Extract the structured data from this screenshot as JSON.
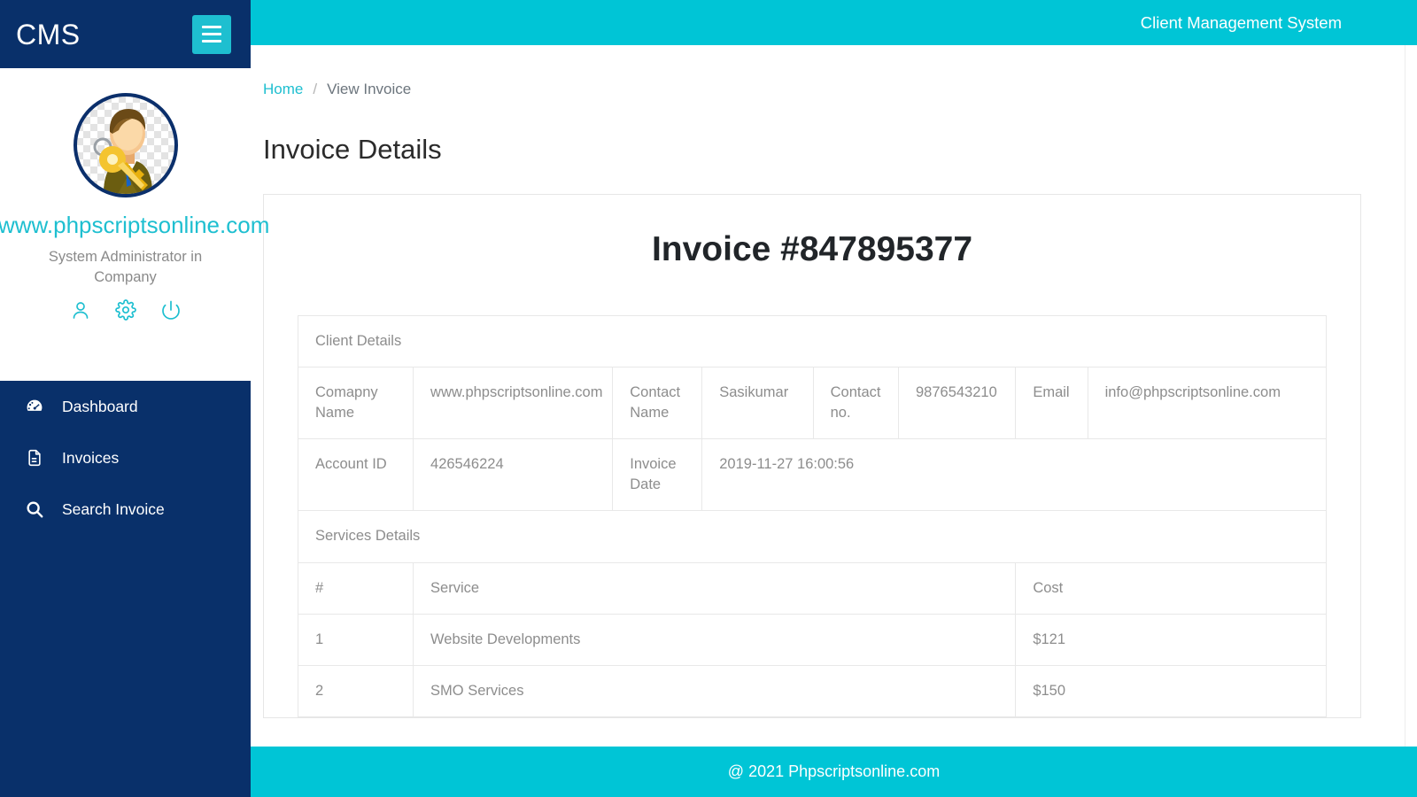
{
  "sidebar": {
    "brand": "CMS",
    "menu_toggle_name": "hamburger-icon",
    "profile": {
      "url": "www.phpscriptsonline.com",
      "role": "System Administrator in Company",
      "actions": [
        {
          "name": "user-icon",
          "label": "Profile"
        },
        {
          "name": "gear-icon",
          "label": "Settings"
        },
        {
          "name": "power-icon",
          "label": "Logout"
        }
      ]
    },
    "nav": [
      {
        "label": "Dashboard",
        "icon": "dashboard-icon"
      },
      {
        "label": "Invoices",
        "icon": "file-icon"
      },
      {
        "label": "Search Invoice",
        "icon": "search-icon"
      }
    ]
  },
  "topbar": {
    "title": "Client Management System"
  },
  "breadcrumb": {
    "home": "Home",
    "separator": "/",
    "current": "View Invoice"
  },
  "page": {
    "title": "Invoice Details",
    "invoice_heading": "Invoice #847895377"
  },
  "client_details": {
    "section_title": "Client Details",
    "rows": [
      {
        "cells": [
          {
            "type": "label",
            "text": "Comapny Name"
          },
          {
            "type": "value",
            "text": "www.phpscriptsonline.com"
          },
          {
            "type": "label",
            "text": "Contact Name"
          },
          {
            "type": "value",
            "text": "Sasikumar"
          },
          {
            "type": "label",
            "text": "Contact no."
          },
          {
            "type": "value",
            "text": "9876543210"
          },
          {
            "type": "label",
            "text": "Email"
          },
          {
            "type": "value",
            "text": "info@phpscriptsonline.com"
          }
        ]
      },
      {
        "cells": [
          {
            "type": "label",
            "text": "Account ID"
          },
          {
            "type": "value",
            "text": "426546224"
          },
          {
            "type": "label",
            "text": "Invoice Date"
          },
          {
            "type": "value",
            "text": "2019-11-27 16:00:56"
          }
        ]
      }
    ]
  },
  "services_details": {
    "section_title": "Services Details",
    "columns": [
      "#",
      "Service",
      "Cost"
    ],
    "rows": [
      {
        "index": "1",
        "service": "Website Developments",
        "cost": "$121"
      },
      {
        "index": "2",
        "service": "SMO Services",
        "cost": "$150"
      }
    ]
  },
  "footer": {
    "text": "@ 2021 Phpscriptsonline.com"
  },
  "colors": {
    "navy": "#09306a",
    "cyan": "#00c5d6",
    "accent_cyan": "#1ebfd0",
    "muted_text": "#8d8d8d",
    "heading": "#212529"
  }
}
